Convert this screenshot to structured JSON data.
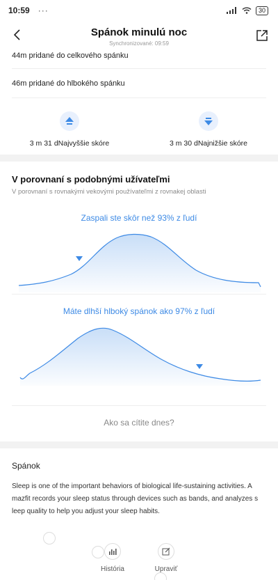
{
  "status": {
    "time": "10:59",
    "dots": "···",
    "battery": "30"
  },
  "header": {
    "title": "Spánok minulú noc",
    "sync": "Synchronizované: 09:59"
  },
  "summary": {
    "items": [
      "44m pridané do celkového spánku",
      "46m pridané do hlbokého spánku"
    ],
    "best": {
      "value": "3 m 31 d",
      "label": "Najvyššie skóre"
    },
    "worst": {
      "value": "3 m 30 d",
      "label": "Najnižšie skóre"
    }
  },
  "comparison": {
    "title": "V porovnaní s podobnými užívateľmi",
    "subtitle": "V porovnaní s rovnakými vekovými používateľmi z rovnakej oblasti",
    "curve1": "Zaspali ste skôr než 93% z ľudí",
    "curve2": "Máte dlhší hlboký spánok ako 97% z ľudí",
    "question": "Ako sa cítite dnes?"
  },
  "info": {
    "heading": "Spánok",
    "text": "Sleep is one of the important behaviors of biological life-sustaining activities. A mazfit records your sleep status through devices such as bands, and analyzes s leep quality to help you adjust your sleep habits."
  },
  "nav": {
    "history": "História",
    "edit": "Upraviť"
  },
  "colors": {
    "accent": "#3d8ae5"
  },
  "icons": {
    "back": "chevron-left-icon",
    "share": "share-icon",
    "up": "arrow-up-icon",
    "down": "arrow-down-icon",
    "history": "bar-chart-icon",
    "edit": "edit-icon"
  }
}
